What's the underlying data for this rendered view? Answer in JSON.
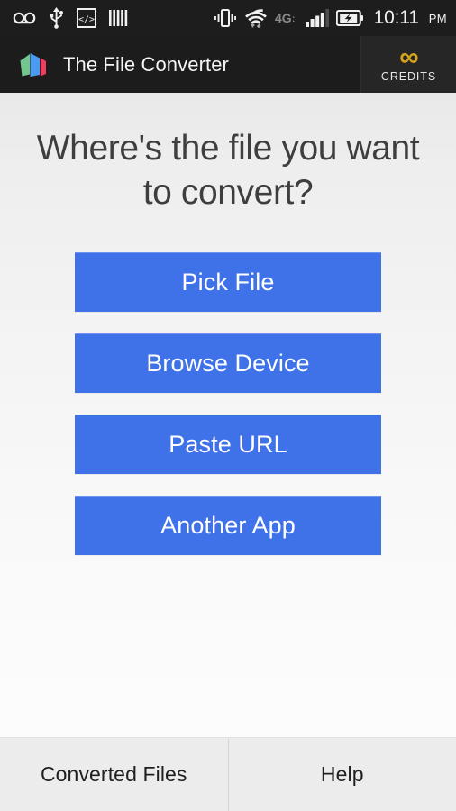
{
  "status_bar": {
    "icons_left": [
      {
        "name": "voicemail-icon",
        "label": "Voicemail"
      },
      {
        "name": "usb-icon",
        "label": "USB connected"
      },
      {
        "name": "developer-options-icon",
        "label": "Developer options"
      },
      {
        "name": "barcode-icon",
        "label": "Barcode scanner"
      }
    ],
    "icons_right": [
      {
        "name": "vibrate-icon",
        "label": "Vibrate mode"
      },
      {
        "name": "wifi-icon",
        "label": "Wi-Fi"
      },
      {
        "name": "network-type-icon",
        "label": "4G"
      },
      {
        "name": "signal-bars-icon",
        "label": "Signal strength"
      },
      {
        "name": "battery-charging-icon",
        "label": "Battery charging"
      }
    ],
    "network_type": "4G",
    "time": "10:11",
    "meridiem": "PM",
    "background": "#1d1d1d"
  },
  "app_bar": {
    "title": "The File Converter",
    "logo_name": "file-converter-logo",
    "logo_colors": [
      "#73c68e",
      "#4a9bf0",
      "#ef3f5e"
    ],
    "background": "#1c1c1c",
    "credits": {
      "icon": "infinity-icon",
      "symbol": "∞",
      "label": "CREDITS",
      "color": "#d6a41c"
    }
  },
  "main": {
    "headline": "Where's the file you want to convert?",
    "accent_color": "#3f72e8",
    "buttons": [
      {
        "id": "pick-file",
        "label": "Pick File"
      },
      {
        "id": "browse-device",
        "label": "Browse Device"
      },
      {
        "id": "paste-url",
        "label": "Paste URL"
      },
      {
        "id": "another-app",
        "label": "Another App"
      }
    ]
  },
  "bottom_bar": {
    "items": [
      {
        "id": "converted-files",
        "label": "Converted Files"
      },
      {
        "id": "help",
        "label": "Help"
      }
    ],
    "background": "#ececec"
  }
}
